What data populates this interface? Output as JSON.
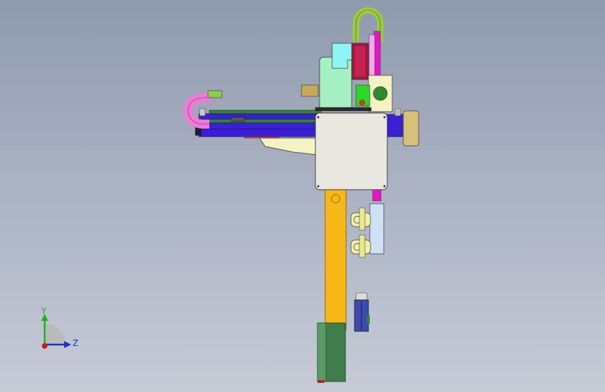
{
  "viewport": {
    "background_top": "#8f9aae",
    "background_bottom": "#c6cbd6"
  },
  "model": {
    "colors": {
      "column": "#f7b817",
      "column_base": "#3f7d4d",
      "main_plate": "#e9e7df",
      "beam": "#3a1fd6",
      "beam_top": "#2e8a2e",
      "cable_chain_pink": "#f07ad8",
      "cable_chain_green": "#9ccc3c",
      "magenta_rail": "#e815c8",
      "motor_mint": "#a4f2c3",
      "cyan_bracket": "#8ef4f4",
      "bracket_cream": "#f5f2c3",
      "dark_red_motor": "#a8143c",
      "gripper_blue": "#cfe0f5",
      "gripper_yellow": "#f0f0a8",
      "cylinder_blue": "#3b4bb0",
      "end_cap_tan": "#d9c07a"
    }
  },
  "triad": {
    "y_label": "Y",
    "z_label": "Z",
    "y_color": "#20b020",
    "z_color": "#1f2fcf",
    "x_color": "#d01818"
  }
}
